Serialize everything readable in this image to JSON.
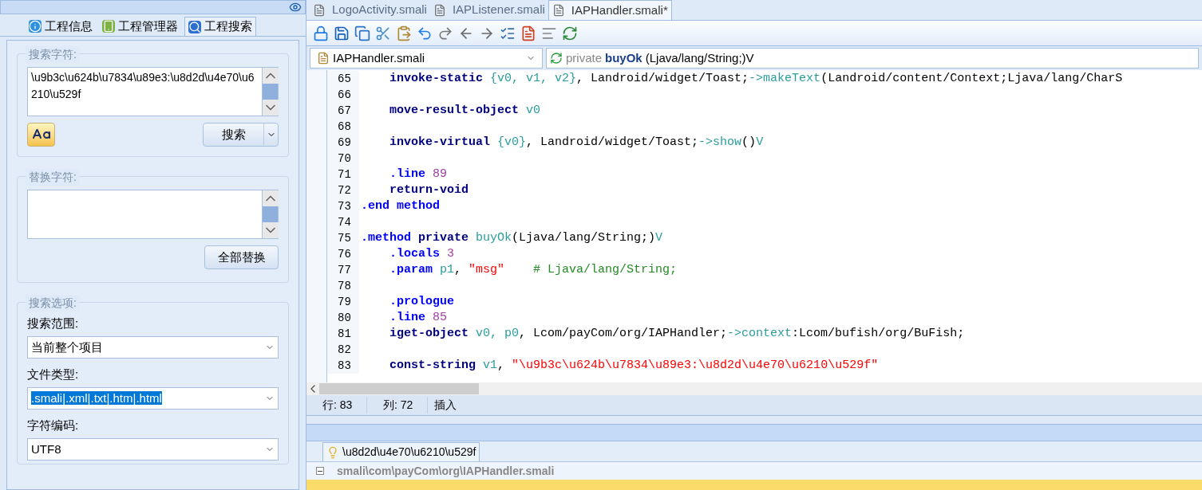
{
  "left_panel": {
    "tabs": [
      {
        "label": "工程信息",
        "selected": false
      },
      {
        "label": "工程管理器",
        "selected": false
      },
      {
        "label": "工程搜索",
        "selected": true
      }
    ],
    "search_group": {
      "title": "搜索字符:",
      "value": "\\u9b3c\\u624b\\u7834\\u89e3:\\u8d2d\\u4e70\\u6210\\u529f",
      "button": "搜索"
    },
    "replace_group": {
      "title": "替换字符:",
      "button": "全部替换"
    },
    "options_group": {
      "title": "搜索选项:",
      "fields": [
        {
          "label": "搜索范围:",
          "value": "当前整个项目",
          "highlighted": false
        },
        {
          "label": "文件类型:",
          "value": ".smali|.xml|.txt|.htm|.html",
          "highlighted": true
        },
        {
          "label": "字符编码:",
          "value": "UTF8",
          "highlighted": false
        }
      ]
    }
  },
  "editor": {
    "tabs": [
      {
        "label": "LogoActivity.smali",
        "selected": false
      },
      {
        "label": "IAPListener.smali",
        "selected": false
      },
      {
        "label": "IAPHandler.smali*",
        "selected": true
      }
    ],
    "file_select": "IAPHandler.smali",
    "method_select": {
      "modifier": "private",
      "name": "buyOk",
      "signature": "(Ljava/lang/String;)V"
    },
    "lines": [
      {
        "number": "65",
        "indent": true,
        "tokens": [
          {
            "kind": "op",
            "text": "invoke-static "
          },
          {
            "kind": "reg",
            "text": "{v0, v1, v2}"
          },
          {
            "kind": "plain",
            "text": ", Landroid/widget/Toast;"
          },
          {
            "kind": "call",
            "text": "->makeText"
          },
          {
            "kind": "plain",
            "text": "(Landroid/content/Context;Ljava/lang/CharS"
          }
        ]
      },
      {
        "number": "66"
      },
      {
        "number": "67",
        "indent": true,
        "tokens": [
          {
            "kind": "op",
            "text": "move-result-object "
          },
          {
            "kind": "reg",
            "text": "v0"
          }
        ]
      },
      {
        "number": "68"
      },
      {
        "number": "69",
        "indent": true,
        "tokens": [
          {
            "kind": "op",
            "text": "invoke-virtual "
          },
          {
            "kind": "reg",
            "text": "{v0}"
          },
          {
            "kind": "plain",
            "text": ", Landroid/widget/Toast;"
          },
          {
            "kind": "call",
            "text": "->show"
          },
          {
            "kind": "plain",
            "text": "()"
          },
          {
            "kind": "reg",
            "text": "V"
          }
        ]
      },
      {
        "number": "70"
      },
      {
        "number": "71",
        "indent": true,
        "tokens": [
          {
            "kind": "directive",
            "text": ".line "
          },
          {
            "kind": "num",
            "text": "89"
          }
        ]
      },
      {
        "number": "72",
        "indent": true,
        "tokens": [
          {
            "kind": "op",
            "text": "return-void"
          }
        ]
      },
      {
        "number": "73",
        "indent": false,
        "tokens": [
          {
            "kind": "directive",
            "text": ".end method"
          }
        ]
      },
      {
        "number": "74"
      },
      {
        "number": "75",
        "indent": false,
        "tokens": [
          {
            "kind": "directive",
            "text": ".method "
          },
          {
            "kind": "op",
            "text": "private "
          },
          {
            "kind": "call",
            "text": "buyOk"
          },
          {
            "kind": "plain",
            "text": "(Ljava/lang/String;)"
          },
          {
            "kind": "reg",
            "text": "V"
          }
        ]
      },
      {
        "number": "76",
        "indent": true,
        "tokens": [
          {
            "kind": "directive",
            "text": ".locals "
          },
          {
            "kind": "num",
            "text": "3"
          }
        ]
      },
      {
        "number": "77",
        "indent": true,
        "tokens": [
          {
            "kind": "directive",
            "text": ".param "
          },
          {
            "kind": "reg",
            "text": "p1"
          },
          {
            "kind": "plain",
            "text": ", "
          },
          {
            "kind": "str",
            "text": "\"msg\""
          },
          {
            "kind": "comment",
            "text": "# Ljava/lang/String;"
          }
        ]
      },
      {
        "number": "78"
      },
      {
        "number": "79",
        "indent": true,
        "tokens": [
          {
            "kind": "directive",
            "text": ".prologue"
          }
        ]
      },
      {
        "number": "80",
        "indent": true,
        "tokens": [
          {
            "kind": "directive",
            "text": ".line "
          },
          {
            "kind": "num",
            "text": "85"
          }
        ]
      },
      {
        "number": "81",
        "indent": true,
        "tokens": [
          {
            "kind": "op",
            "text": "iget-object "
          },
          {
            "kind": "reg",
            "text": "v0, p0"
          },
          {
            "kind": "plain",
            "text": ", Lcom/payCom/org/IAPHandler;"
          },
          {
            "kind": "call",
            "text": "->context"
          },
          {
            "kind": "plain",
            "text": ":Lcom/bufish/org/BuFish;"
          }
        ]
      },
      {
        "number": "82"
      },
      {
        "number": "83",
        "indent": true,
        "tokens": [
          {
            "kind": "op",
            "text": "const-string "
          },
          {
            "kind": "reg",
            "text": "v1"
          },
          {
            "kind": "plain",
            "text": ", "
          },
          {
            "kind": "str",
            "text": "\"\\u9b3c\\u624b\\u7834\\u89e3:\\u8d2d\\u4e70\\u6210\\u529f\""
          }
        ]
      }
    ],
    "status_bar": {
      "row": "行: 83",
      "column": "列: 72",
      "mode": "插入"
    }
  },
  "results": {
    "tab": "\\u8d2d\\u4e70\\u6210\\u529f",
    "file": "smali\\com\\payCom\\org\\IAPHandler.smali",
    "expanded": true
  }
}
